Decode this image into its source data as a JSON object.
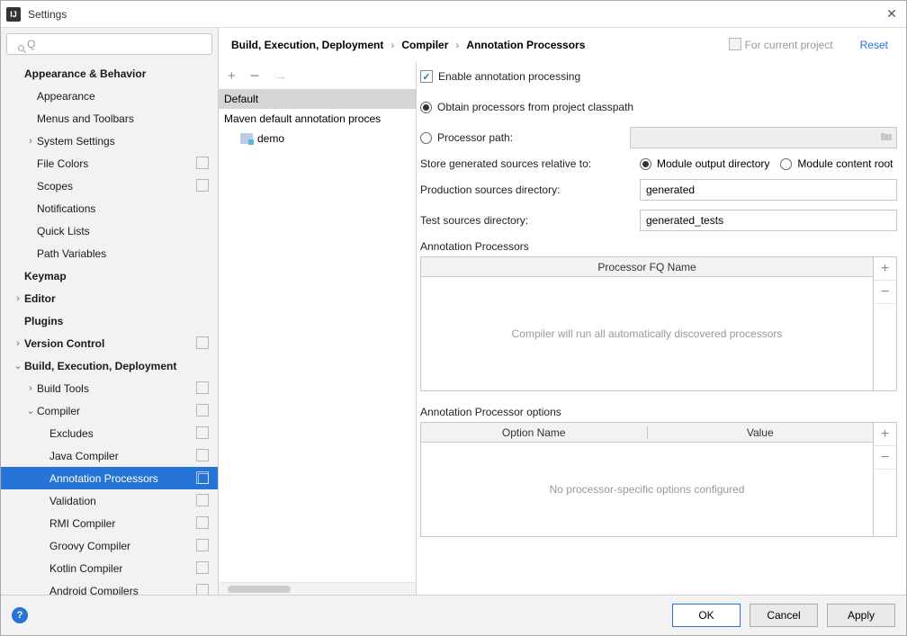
{
  "window": {
    "title": "Settings"
  },
  "search": {
    "placeholder": ""
  },
  "sidebar": {
    "items": [
      {
        "label": "Appearance & Behavior",
        "bold": true,
        "pad": 0,
        "arrow": ""
      },
      {
        "label": "Appearance",
        "pad": 1
      },
      {
        "label": "Menus and Toolbars",
        "pad": 1
      },
      {
        "label": "System Settings",
        "pad": 1,
        "arrow": "›"
      },
      {
        "label": "File Colors",
        "pad": 1,
        "badge": true
      },
      {
        "label": "Scopes",
        "pad": 1,
        "badge": true
      },
      {
        "label": "Notifications",
        "pad": 1
      },
      {
        "label": "Quick Lists",
        "pad": 1
      },
      {
        "label": "Path Variables",
        "pad": 1
      },
      {
        "label": "Keymap",
        "bold": true,
        "pad": 0
      },
      {
        "label": "Editor",
        "bold": true,
        "pad": 0,
        "arrow": "›",
        "arrowPos": "pre"
      },
      {
        "label": "Plugins",
        "bold": true,
        "pad": 0
      },
      {
        "label": "Version Control",
        "bold": true,
        "pad": 0,
        "arrow": "›",
        "arrowPos": "pre",
        "badge": true
      },
      {
        "label": "Build, Execution, Deployment",
        "bold": true,
        "pad": 0,
        "arrow": "⌄",
        "arrowPos": "pre"
      },
      {
        "label": "Build Tools",
        "pad": 1,
        "arrow": "›",
        "badge": true
      },
      {
        "label": "Compiler",
        "pad": 1,
        "arrow": "⌄",
        "badge": true
      },
      {
        "label": "Excludes",
        "pad": 2,
        "badge": true
      },
      {
        "label": "Java Compiler",
        "pad": 2,
        "badge": true
      },
      {
        "label": "Annotation Processors",
        "pad": 2,
        "badge": true,
        "selected": true
      },
      {
        "label": "Validation",
        "pad": 2,
        "badge": true
      },
      {
        "label": "RMI Compiler",
        "pad": 2,
        "badge": true
      },
      {
        "label": "Groovy Compiler",
        "pad": 2,
        "badge": true
      },
      {
        "label": "Kotlin Compiler",
        "pad": 2,
        "badge": true
      },
      {
        "label": "Android Compilers",
        "pad": 2,
        "badge": true
      }
    ]
  },
  "breadcrumb": {
    "a": "Build, Execution, Deployment",
    "b": "Compiler",
    "c": "Annotation Processors"
  },
  "hint": "For current project",
  "reset": "Reset",
  "profiles": {
    "items": [
      {
        "label": "Default",
        "sel": true
      },
      {
        "label": "Maven default annotation proces"
      },
      {
        "label": "demo",
        "indent": true,
        "folder": true
      }
    ]
  },
  "form": {
    "enable": "Enable annotation processing",
    "obtain": "Obtain processors from project classpath",
    "procpath": "Processor path:",
    "storeRel": "Store generated sources relative to:",
    "modOut": "Module output directory",
    "modRoot": "Module content root",
    "prodDir": "Production sources directory:",
    "prodVal": "generated",
    "testDir": "Test sources directory:",
    "testVal": "generated_tests",
    "apTitle": "Annotation Processors",
    "apCol": "Processor FQ Name",
    "apEmpty": "Compiler will run all automatically discovered processors",
    "optTitle": "Annotation Processor options",
    "optCol1": "Option Name",
    "optCol2": "Value",
    "optEmpty": "No processor-specific options configured"
  },
  "footer": {
    "ok": "OK",
    "cancel": "Cancel",
    "apply": "Apply"
  }
}
